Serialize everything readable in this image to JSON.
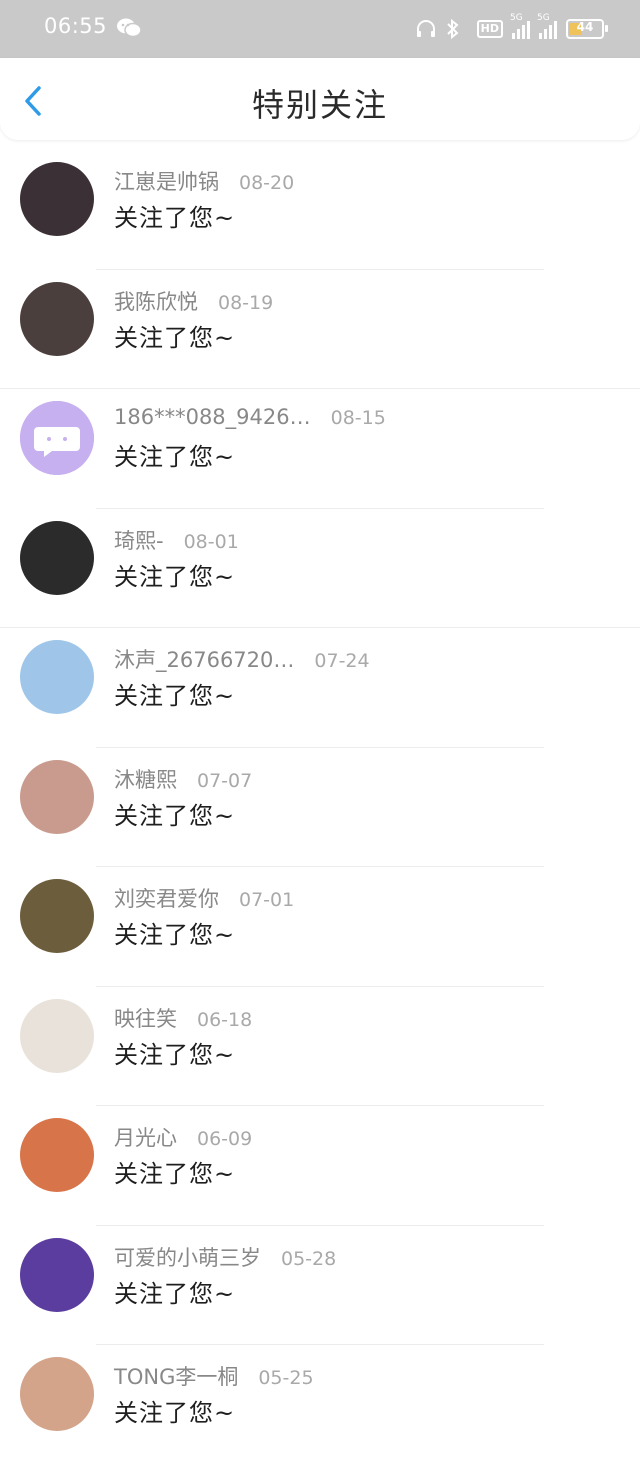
{
  "status_bar": {
    "time": "06:55",
    "network_1": "5G",
    "network_2": "5G",
    "hd": "HD",
    "battery": "44",
    "battery_level": 0.44
  },
  "header": {
    "title": "特别关注"
  },
  "list": [
    {
      "name": "江崽是帅锅",
      "date": "08-20",
      "message": "关注了您~",
      "avatar_color": "#3b3035"
    },
    {
      "name": "我陈欣悦",
      "date": "08-19",
      "message": "关注了您~",
      "avatar_color": "#4b3f3e"
    },
    {
      "name": "186***088_9426…",
      "date": "08-15",
      "message": "关注了您~",
      "avatar_color": "#c6b0ef"
    },
    {
      "name": "琦熙-",
      "date": "08-01",
      "message": "关注了您~",
      "avatar_color": "#2b2b2b"
    },
    {
      "name": "沐声_26766720…",
      "date": "07-24",
      "message": "关注了您~",
      "avatar_color": "#9fc6e9"
    },
    {
      "name": "沐糖熙",
      "date": "07-07",
      "message": "关注了您~",
      "avatar_color": "#c89b8e"
    },
    {
      "name": "刘奕君爱你",
      "date": "07-01",
      "message": "关注了您~",
      "avatar_color": "#6c5d3c"
    },
    {
      "name": "映往笑",
      "date": "06-18",
      "message": "关注了您~",
      "avatar_color": "#e8e2da"
    },
    {
      "name": "月光心",
      "date": "06-09",
      "message": "关注了您~",
      "avatar_color": "#d8744a"
    },
    {
      "name": "可爱的小萌三岁",
      "date": "05-28",
      "message": "关注了您~",
      "avatar_color": "#5a3d9e"
    },
    {
      "name": "TONG李一桐",
      "date": "05-25",
      "message": "关注了您~",
      "avatar_color": "#d3a38a"
    }
  ],
  "colors": {
    "accent": "#2e9be6",
    "status_bar_bg": "#c9c9c9"
  }
}
